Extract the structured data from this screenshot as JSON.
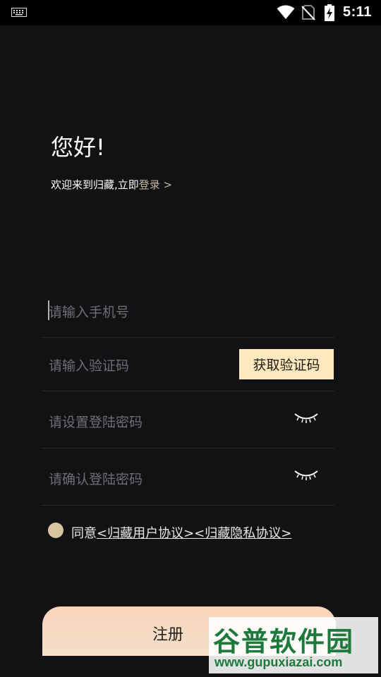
{
  "status_bar": {
    "time": "5:11"
  },
  "header": {
    "greeting": "您好!",
    "subtitle_prefix": "欢迎来到归藏,立即",
    "login_link": "登录 >"
  },
  "form": {
    "phone_placeholder": "请输入手机号",
    "code_placeholder": "请输入验证码",
    "get_code_label": "获取验证码",
    "password_placeholder": "请设置登陆密码",
    "confirm_placeholder": "请确认登陆密码"
  },
  "agreement": {
    "prefix": "同意",
    "user_agreement": "<归藏用户协议>",
    "privacy_agreement": "<归藏隐私协议>"
  },
  "register_label": "注册",
  "watermark": {
    "title": "谷普软件园",
    "url": "www.gupuxiazai.com"
  },
  "icons": {
    "keyboard": "keyboard-icon",
    "wifi": "wifi-icon",
    "no_sim": "no-sim-icon",
    "battery": "battery-charging-icon",
    "eye_closed": "eye-closed-icon"
  },
  "colors": {
    "background": "#121114",
    "accent": "#c8b69a",
    "code_button": "#fde9bd",
    "agree_dot": "#d8c59f"
  }
}
